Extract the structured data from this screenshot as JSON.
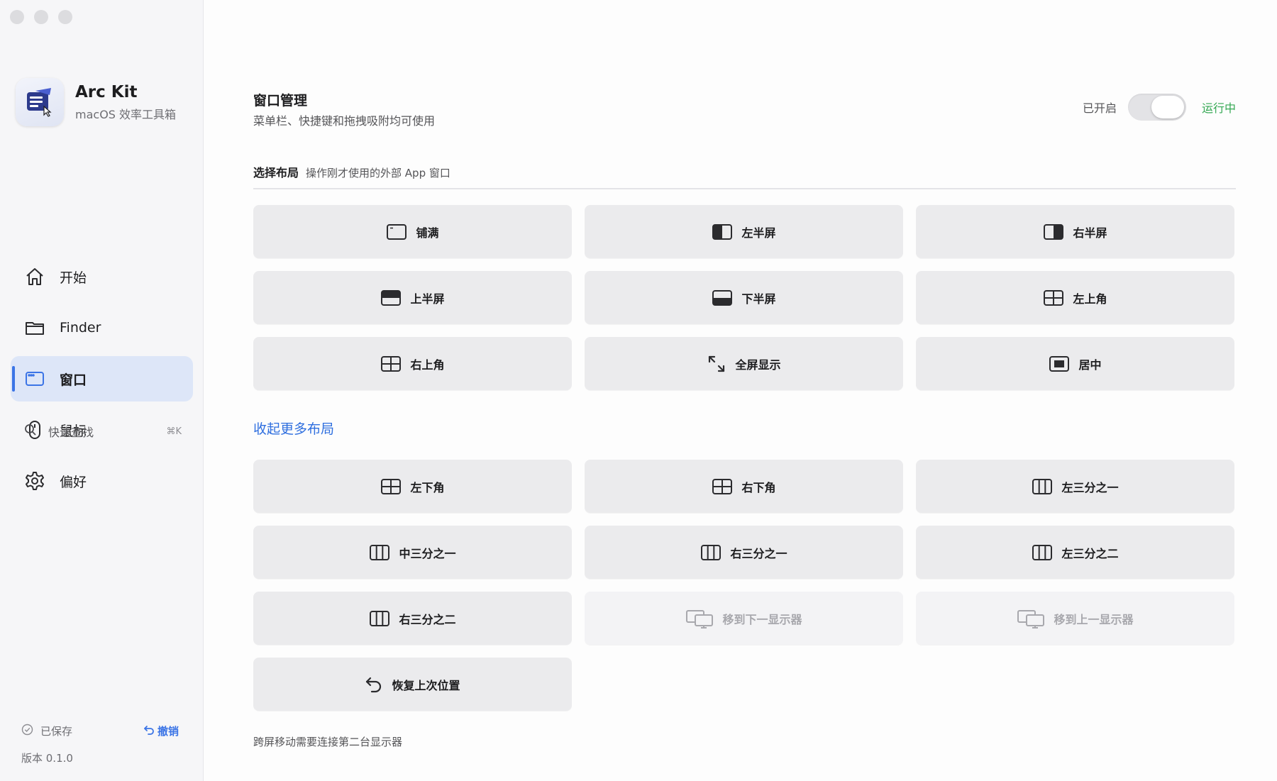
{
  "app": {
    "name": "Arc Kit",
    "subtitle": "macOS 效率工具箱"
  },
  "sidebar": {
    "items": [
      {
        "label": "开始",
        "icon": "home-icon"
      },
      {
        "label": "Finder",
        "icon": "folder-icon"
      },
      {
        "label": "窗口",
        "icon": "window-icon",
        "active": true
      },
      {
        "label": "鼠标",
        "icon": "mouse-icon"
      },
      {
        "label": "偏好",
        "icon": "gear-icon"
      }
    ],
    "search": {
      "label": "快速查找",
      "shortcut": "⌘K"
    },
    "saved_label": "已保存",
    "undo_label": "撤销",
    "version": "版本 0.1.0"
  },
  "header": {
    "title": "窗口管理",
    "subtitle": "菜单栏、快捷键和拖拽吸附均可使用",
    "toggle_label": "已开启",
    "toggle_on": true,
    "status": "运行中"
  },
  "section": {
    "title": "选择布局",
    "hint": "操作刚才使用的外部 App 窗口"
  },
  "layouts": [
    {
      "label": "铺满",
      "icon": "fill-window-icon"
    },
    {
      "label": "左半屏",
      "icon": "left-half-icon"
    },
    {
      "label": "右半屏",
      "icon": "right-half-icon"
    },
    {
      "label": "上半屏",
      "icon": "top-half-icon"
    },
    {
      "label": "下半屏",
      "icon": "bottom-half-icon"
    },
    {
      "label": "左上角",
      "icon": "quadrant-icon"
    },
    {
      "label": "右上角",
      "icon": "quadrant-icon"
    },
    {
      "label": "全屏显示",
      "icon": "fullscreen-arrows-icon"
    },
    {
      "label": "居中",
      "icon": "center-window-icon"
    }
  ],
  "more_link": "收起更多布局",
  "more_layouts": [
    {
      "label": "左下角",
      "icon": "quadrant-icon"
    },
    {
      "label": "右下角",
      "icon": "quadrant-icon"
    },
    {
      "label": "左三分之一",
      "icon": "thirds-icon"
    },
    {
      "label": "中三分之一",
      "icon": "thirds-icon"
    },
    {
      "label": "右三分之一",
      "icon": "thirds-icon"
    },
    {
      "label": "左三分之二",
      "icon": "thirds-icon"
    },
    {
      "label": "右三分之二",
      "icon": "thirds-icon"
    },
    {
      "label": "移到下一显示器",
      "icon": "displays-icon",
      "disabled": true
    },
    {
      "label": "移到上一显示器",
      "icon": "displays-icon",
      "disabled": true
    },
    {
      "label": "恢复上次位置",
      "icon": "restore-arrow-icon"
    }
  ],
  "footnote": "跨屏移动需要连接第二台显示器",
  "colors": {
    "accent": "#3b74e6",
    "running": "#34a853",
    "active_bg": "#dde6f8",
    "button_bg": "#ebebed"
  }
}
